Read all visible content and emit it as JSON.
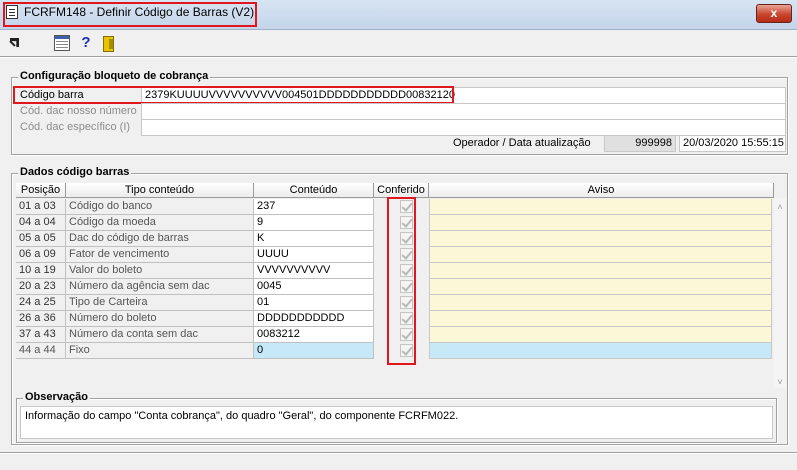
{
  "window": {
    "title": "FCRFM148 - Definir Código de Barras (V2)",
    "close_label": "x"
  },
  "config_group": {
    "title": "Configuração bloqueto de cobrança",
    "codigo_barra_label": "Código barra",
    "codigo_barra_value": "2379KUUUUVVVVVVVVVV004501DDDDDDDDDDD00832120",
    "dac_nosso_numero_label": "Cód. dac nosso número",
    "dac_nosso_numero_value": "",
    "dac_especifico_label": "Cód. dac específico (I)",
    "dac_especifico_value": "",
    "operador_label": "Operador / Data atualização",
    "operador_value": "999998",
    "data_value": "20/03/2020 15:55:15"
  },
  "dados_group": {
    "title": "Dados código barras",
    "columns": {
      "posicao": "Posição",
      "tipo": "Tipo conteúdo",
      "conteudo": "Conteúdo",
      "conferido": "Conferido",
      "aviso": "Aviso"
    },
    "rows": [
      {
        "posicao": "01 a 03",
        "tipo": "Código do banco",
        "conteudo": "237",
        "conferido": true,
        "aviso": ""
      },
      {
        "posicao": "04 a 04",
        "tipo": "Código da moeda",
        "conteudo": "9",
        "conferido": true,
        "aviso": ""
      },
      {
        "posicao": "05 a 05",
        "tipo": "Dac do código de barras",
        "conteudo": "K",
        "conferido": true,
        "aviso": ""
      },
      {
        "posicao": "06 a 09",
        "tipo": "Fator de vencimento",
        "conteudo": "UUUU",
        "conferido": true,
        "aviso": ""
      },
      {
        "posicao": "10 a 19",
        "tipo": "Valor do boleto",
        "conteudo": "VVVVVVVVVV",
        "conferido": true,
        "aviso": ""
      },
      {
        "posicao": "20 a 23",
        "tipo": "Número da agência sem dac",
        "conteudo": "0045",
        "conferido": true,
        "aviso": ""
      },
      {
        "posicao": "24 a 25",
        "tipo": "Tipo de Carteira",
        "conteudo": "01",
        "conferido": true,
        "aviso": ""
      },
      {
        "posicao": "26 a 36",
        "tipo": "Número do boleto",
        "conteudo": "DDDDDDDDDDD",
        "conferido": true,
        "aviso": ""
      },
      {
        "posicao": "37 a 43",
        "tipo": "Número da conta sem dac",
        "conteudo": "0083212",
        "conferido": true,
        "aviso": ""
      },
      {
        "posicao": "44 a 44",
        "tipo": "Fixo",
        "conteudo": "0",
        "conferido": true,
        "aviso": ""
      }
    ]
  },
  "observacao": {
    "title": "Observação",
    "text": "Informação do campo \"Conta cobrança\", do quadro \"Geral\", do componente FCRFM022."
  },
  "toolbar": {
    "icons": [
      "exit-arrow-icon",
      "grid-icon",
      "help-icon",
      "door-exit-icon"
    ]
  },
  "colors": {
    "highlight_red": "#e0181e",
    "aviso_bg": "#fbf7d7",
    "selected_row_bg": "#c7e8f6"
  }
}
